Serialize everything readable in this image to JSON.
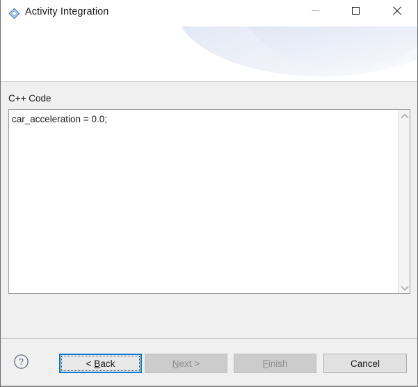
{
  "window": {
    "title": "Activity Integration",
    "icon": "diamond-shape-icon",
    "controls": {
      "minimize_label": "Minimize",
      "maximize_label": "Maximize",
      "close_label": "Close"
    }
  },
  "header": {
    "banner_accent_color": "#cdd8ee",
    "background_color": "#ffffff"
  },
  "content": {
    "field_label": "C++ Code",
    "code_value": "car_acceleration = 0.0;",
    "code_placeholder": "",
    "scrollbar": {
      "up_icon": "chevron-up-icon",
      "down_icon": "chevron-down-icon"
    }
  },
  "buttonbar": {
    "help_icon": "question-mark-circle-icon",
    "buttons": [
      {
        "name": "back",
        "prefix": "< ",
        "mnemonic": "B",
        "rest": "ack",
        "suffix": "",
        "enabled": true,
        "focused": true
      },
      {
        "name": "next",
        "prefix": "",
        "mnemonic": "N",
        "rest": "ext",
        "suffix": " >",
        "enabled": false,
        "focused": false
      },
      {
        "name": "finish",
        "prefix": "",
        "mnemonic": "F",
        "rest": "inish",
        "suffix": "",
        "enabled": false,
        "focused": false
      },
      {
        "name": "cancel",
        "prefix": "",
        "mnemonic": "",
        "rest": "Cancel",
        "suffix": "",
        "enabled": true,
        "focused": false
      }
    ],
    "labels": {
      "back": "< Back",
      "next": "Next >",
      "finish": "Finish",
      "cancel": "Cancel"
    }
  },
  "colors": {
    "focus_blue": "#0078d7",
    "disabled_text": "#8d8d8d",
    "dialog_gray": "#f0f0f0",
    "border_gray": "#9a9a9a"
  }
}
